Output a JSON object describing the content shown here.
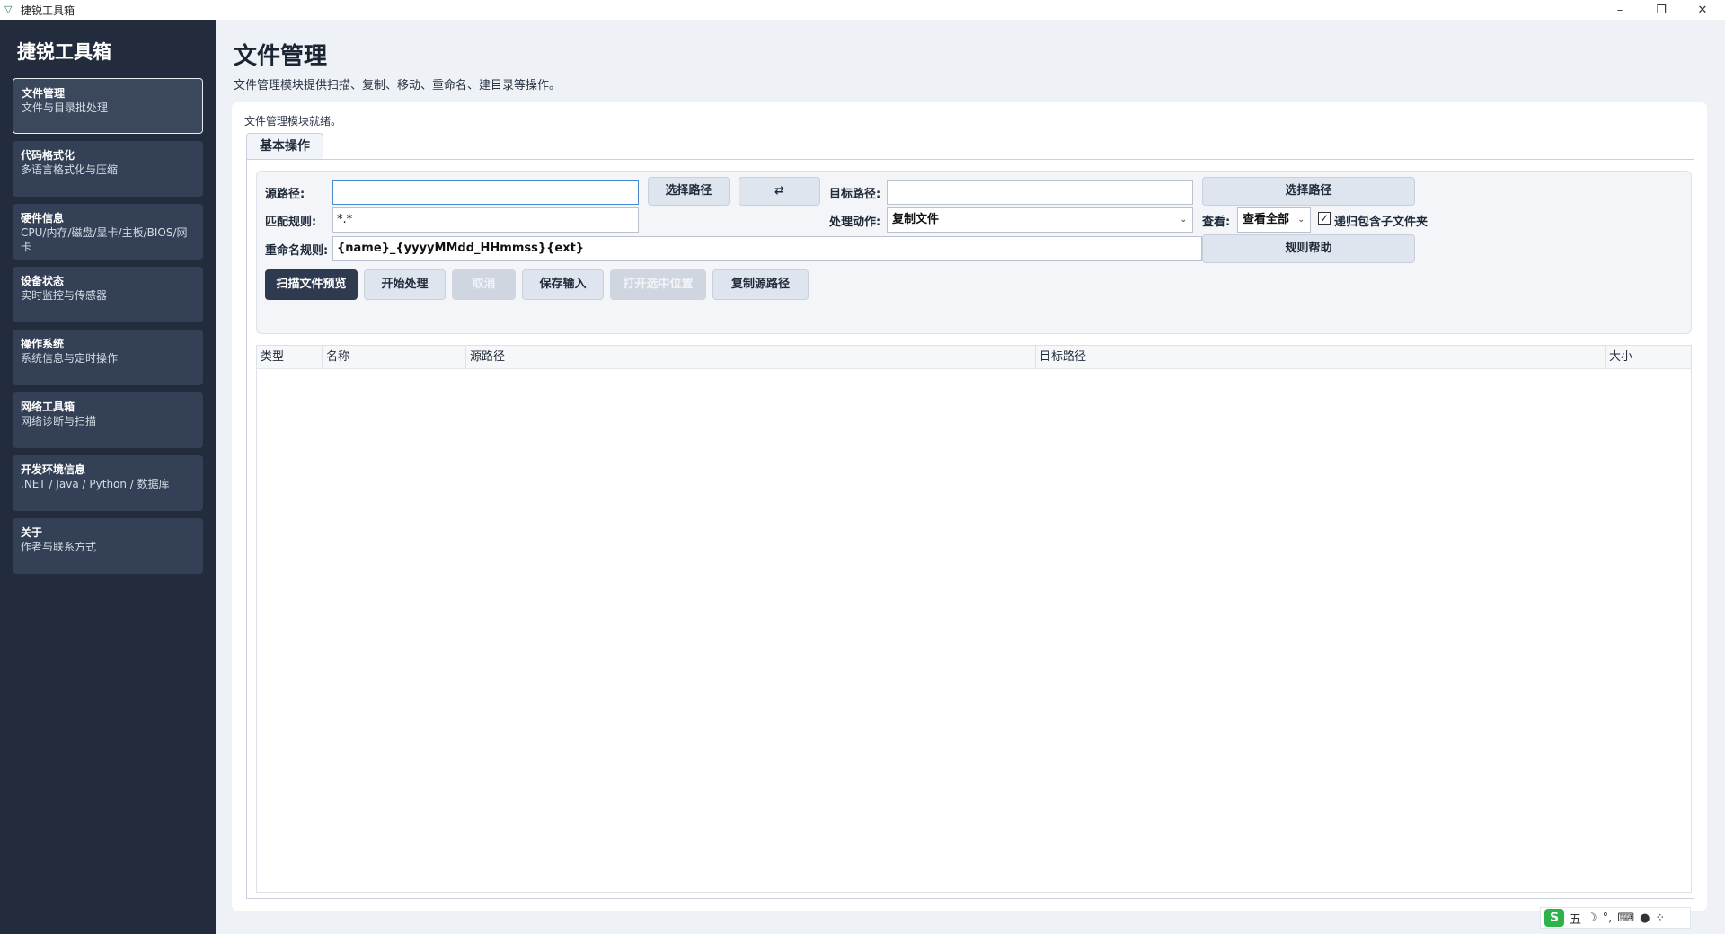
{
  "window": {
    "title": "捷锐工具箱",
    "minimize": "–",
    "restore": "❐",
    "close": "✕"
  },
  "sidebar": {
    "brand": "捷锐工具箱",
    "items": [
      {
        "title": "文件管理",
        "sub": "文件与目录批处理"
      },
      {
        "title": "代码格式化",
        "sub": "多语言格式化与压缩"
      },
      {
        "title": "硬件信息",
        "sub": "CPU/内存/磁盘/显卡/主板/BIOS/网卡"
      },
      {
        "title": "设备状态",
        "sub": "实时监控与传感器"
      },
      {
        "title": "操作系统",
        "sub": "系统信息与定时操作"
      },
      {
        "title": "网络工具箱",
        "sub": "网络诊断与扫描"
      },
      {
        "title": "开发环境信息",
        "sub": ".NET / Java / Python / 数据库"
      },
      {
        "title": "关于",
        "sub": "作者与联系方式"
      }
    ]
  },
  "main": {
    "title": "文件管理",
    "desc": "文件管理模块提供扫描、复制、移动、重命名、建目录等操作。",
    "status": "文件管理模块就绪。",
    "tab": "基本操作"
  },
  "form": {
    "source_label": "源路径:",
    "source_value": "",
    "choose_source": "选择路径",
    "swap": "⇄",
    "target_label": "目标路径:",
    "target_value": "",
    "choose_target": "选择路径",
    "pattern_label": "匹配规则:",
    "pattern_value": "*.*",
    "action_label": "处理动作:",
    "action_value": "复制文件",
    "view_label": "查看:",
    "view_value": "查看全部",
    "recursive_label": "递归包含子文件夹",
    "recursive_checked": "✓",
    "rename_label": "重命名规则:",
    "rename_value": "{name}_{yyyyMMdd_HHmmss}{ext}",
    "rule_help": "规则帮助"
  },
  "actions": {
    "scan": "扫描文件预览",
    "start": "开始处理",
    "cancel": "取消",
    "save_input": "保存输入",
    "open_selected": "打开选中位置",
    "copy_source": "复制源路径"
  },
  "table": {
    "columns": [
      "类型",
      "名称",
      "源路径",
      "目标路径",
      "大小"
    ],
    "rows": []
  },
  "tray": {
    "ime": "S",
    "mode": "五",
    "moon": "☽",
    "punct": "°,",
    "keyboard": "⌨",
    "user": "●",
    "grid": "⁘"
  }
}
